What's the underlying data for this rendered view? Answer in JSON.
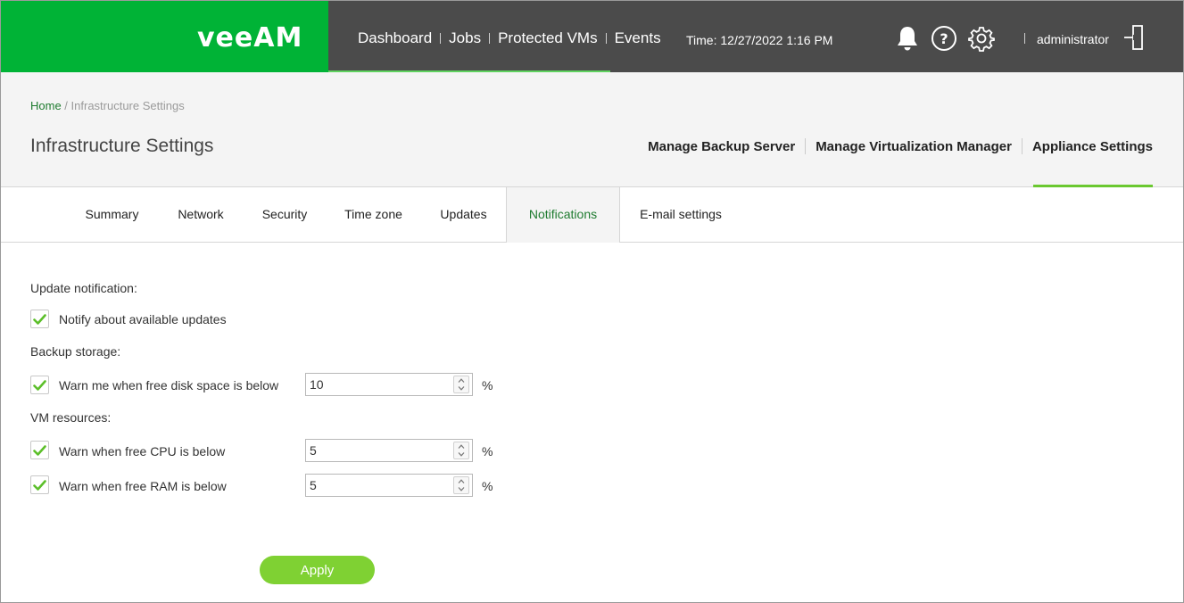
{
  "brand": {
    "logo_text": "veeAM",
    "color": "#00b336"
  },
  "nav": {
    "items": [
      "Dashboard",
      "Jobs",
      "Protected VMs",
      "Events"
    ]
  },
  "time": "Time: 12/27/2022 1:16 PM",
  "topbar_icons": [
    "bell-icon",
    "help-icon",
    "gear-icon",
    "logout-icon"
  ],
  "user": "administrator",
  "breadcrumb": {
    "home": "Home",
    "separator": " / ",
    "current": "Infrastructure Settings"
  },
  "page_title": "Infrastructure Settings",
  "section_nav": {
    "items": [
      "Manage Backup Server",
      "Manage Virtualization Manager",
      "Appliance Settings"
    ],
    "active": "Appliance Settings"
  },
  "tabs": {
    "items": [
      "Summary",
      "Network",
      "Security",
      "Time zone",
      "Updates",
      "Notifications",
      "E-mail settings"
    ],
    "active": "Notifications"
  },
  "form": {
    "update_label": "Update notification:",
    "notify_updates": {
      "label": "Notify about available updates",
      "checked": true
    },
    "storage_label": "Backup storage:",
    "disk_warn": {
      "label": "Warn me when free disk space is below",
      "checked": true,
      "value": "10",
      "unit": "%"
    },
    "vm_label": "VM resources:",
    "cpu_warn": {
      "label": "Warn when free CPU is below",
      "checked": true,
      "value": "5",
      "unit": "%"
    },
    "ram_warn": {
      "label": "Warn when free RAM is below",
      "checked": true,
      "value": "5",
      "unit": "%"
    },
    "apply_label": "Apply"
  },
  "colors": {
    "accent": "#6ac830",
    "topbar": "#4b4b4b",
    "link": "#1e7b2f",
    "check": "#5cbf2a"
  }
}
